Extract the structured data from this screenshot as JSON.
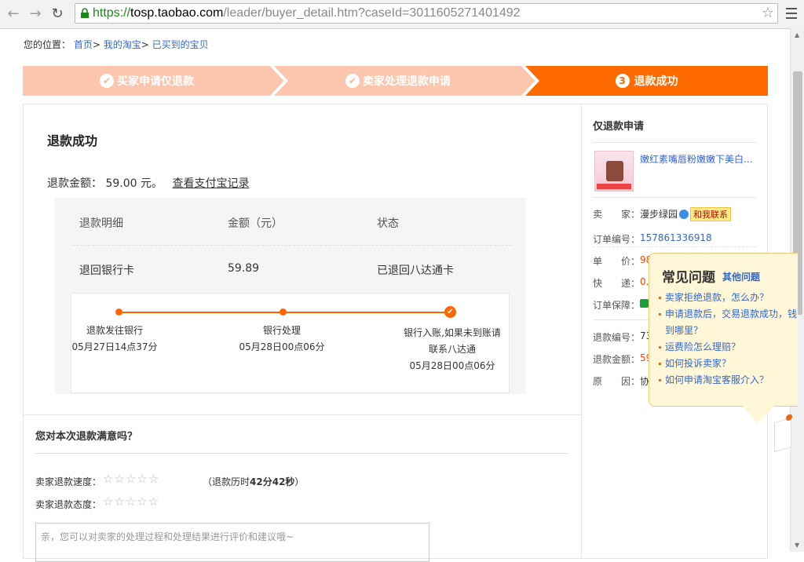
{
  "browser": {
    "url_protocol": "https://",
    "url_host": "tosp.taobao.com",
    "url_path": "/leader/buyer_detail.htm?caseId=3011605271401492"
  },
  "breadcrumb": {
    "label": "您的位置：",
    "items": [
      "首页",
      "我的淘宝",
      "已买到的宝贝"
    ],
    "separator": ">"
  },
  "steps": [
    {
      "label": "买家申请仅退款",
      "state": "done"
    },
    {
      "label": "卖家处理退款申请",
      "state": "done"
    },
    {
      "label": "退款成功",
      "state": "current",
      "number": "3"
    }
  ],
  "main": {
    "title": "退款成功",
    "amount_label": "退款金额：",
    "amount_value": "59.00",
    "amount_unit": "元。",
    "alipay_link": "查看支付宝记录",
    "table": {
      "headers": [
        "退款明细",
        "金额（元）",
        "状态"
      ],
      "row": [
        "退回银行卡",
        "59.89",
        "已退回八达通卡"
      ]
    },
    "progress": [
      {
        "line1": "退款发往银行",
        "line2": "05月27日14点37分"
      },
      {
        "line1": "银行处理",
        "line2": "05月28日00点06分"
      },
      {
        "line1": "银行入账,如果未到账请",
        "line2": "联系八达通",
        "line3": "05月28日00点06分"
      }
    ]
  },
  "satisfaction": {
    "title": "您对本次退款满意吗？",
    "speed_label": "卖家退款速度：",
    "attitude_label": "卖家退款态度：",
    "stars": "☆☆☆☆☆",
    "elapsed_prefix": "（退款历时",
    "elapsed_value": "42分42秒",
    "elapsed_suffix": "）",
    "comment_placeholder": "亲，您可以对卖家的处理过程和处理结果进行评价和建议哦~"
  },
  "side": {
    "title": "仅退款申请",
    "product_name": "嫩红素嘴唇粉嫩嫩下美白...",
    "seller_label": "卖　　家：",
    "seller_name": "漫步绿园",
    "contact_label": "和我联系",
    "order_no_label": "订单编号：",
    "order_no": "157861336918",
    "price_label": "单　　价：",
    "price_partial": "98",
    "express_label": "快　　递：",
    "express_partial": "0.",
    "guarantee_label": "订单保障：",
    "refund_no_label": "退款编号：",
    "refund_no_partial": "73",
    "refund_amount_label": "退款金额：",
    "refund_amount_partial": "59",
    "reason_label": "原　　因：",
    "reason_partial": "协"
  },
  "faq": {
    "title": "常见问题",
    "more": "其他问题",
    "items": [
      "卖家拒绝退款，怎么办？",
      "申请退款后，交易退款成功，钱",
      "到哪里？",
      "运费险怎么理赔？",
      "如何投诉卖家？",
      "如何申请淘宝客服介入？"
    ]
  }
}
